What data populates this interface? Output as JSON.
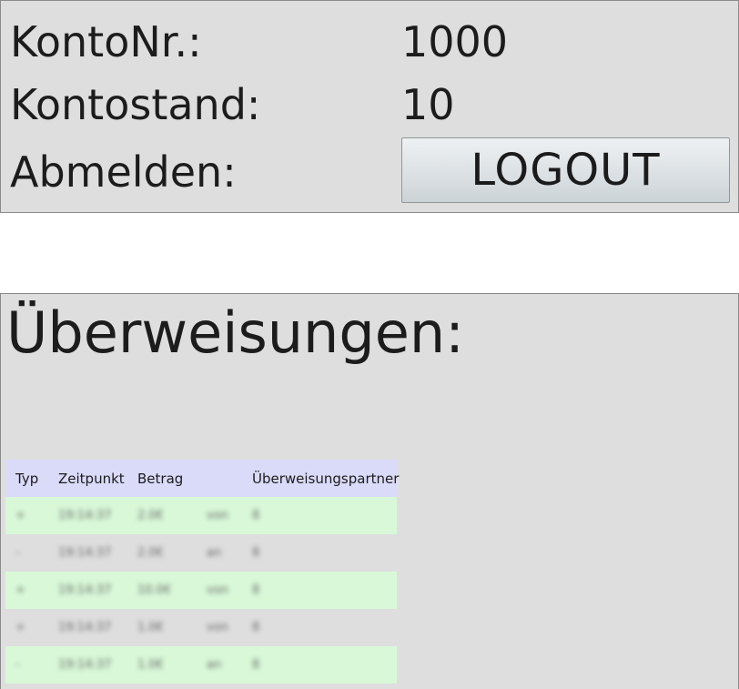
{
  "account": {
    "number_label": "KontoNr.:",
    "number_value": "1000",
    "balance_label": "Kontostand:",
    "balance_value": "10",
    "logout_label": "Abmelden:",
    "logout_button": "LOGOUT"
  },
  "transfers": {
    "title": "Überweisungen:",
    "headers": [
      "Typ",
      "Zeitpunkt",
      "Betrag",
      "",
      "Überweisungspartner"
    ],
    "rows": [
      [
        "+",
        "19:14:37",
        "2.0€",
        "von",
        "8"
      ],
      [
        "-",
        "19:14:37",
        "2.0€",
        "an",
        "8"
      ],
      [
        "+",
        "19:14:37",
        "10.0€",
        "von",
        "8"
      ],
      [
        "+",
        "19:14:37",
        "1.0€",
        "von",
        "8"
      ],
      [
        "-",
        "19:14:37",
        "1.0€",
        "an",
        "8"
      ]
    ]
  },
  "colors": {
    "panel_bg": "#dedede",
    "header_bg": "#dadaf9",
    "row_even_bg": "#d8f8d8"
  }
}
